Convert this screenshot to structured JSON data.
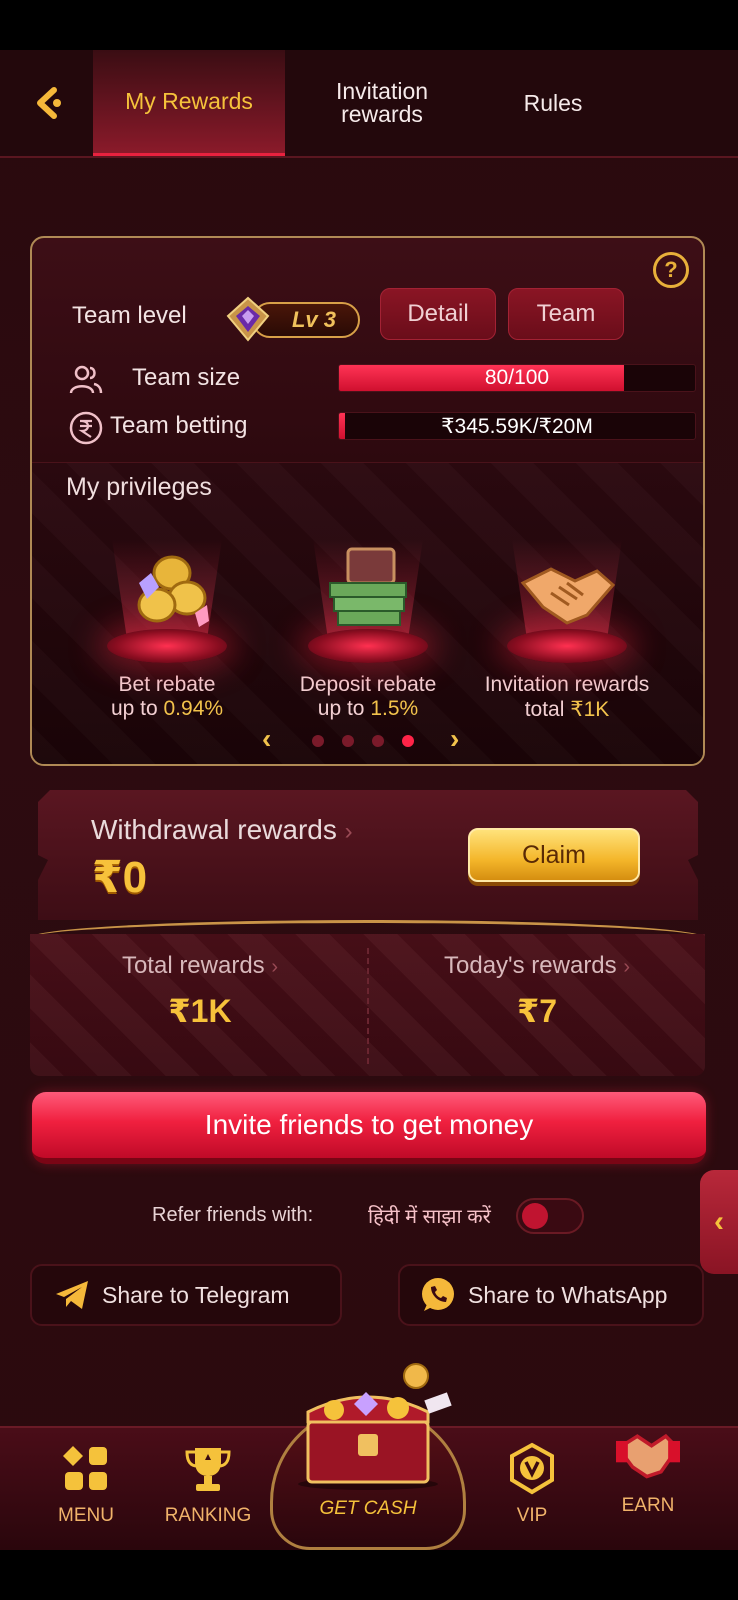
{
  "header": {
    "tabs": [
      {
        "label": "My Rewards",
        "active": true
      },
      {
        "label": "Invitation rewards",
        "active": false
      },
      {
        "label": "Rules",
        "active": false
      }
    ]
  },
  "team": {
    "level_label": "Team level",
    "level_badge": "Lv 3",
    "detail_label": "Detail",
    "team_label": "Team",
    "size_label": "Team size",
    "size_text": "80/100",
    "size_progress": 0.8,
    "betting_label": "Team betting",
    "betting_text": "₹345.59K/₹20M",
    "betting_progress": 0.017
  },
  "privileges": {
    "title": "My privileges",
    "items": [
      {
        "line1": "Bet rebate",
        "prefix": "up to ",
        "value": "0.94%"
      },
      {
        "line1": "Deposit rebate",
        "prefix": "up to ",
        "value": "1.5%"
      },
      {
        "line1": "Invitation rewards",
        "prefix": "total ",
        "value": "₹1K"
      }
    ],
    "pager_active_index": 3,
    "pager_count": 4
  },
  "withdrawal": {
    "label": "Withdrawal rewards",
    "amount": "₹0",
    "claim_label": "Claim"
  },
  "summary": {
    "total_label": "Total rewards",
    "total_value": "₹1K",
    "today_label": "Today's rewards",
    "today_value": "₹7"
  },
  "invite": {
    "button_label": "Invite friends to get money",
    "refer_label": "Refer friends with:",
    "hindi_label": "हिंदी में साझा करें",
    "hindi_enabled": false
  },
  "share": {
    "telegram_label": "Share to Telegram",
    "whatsapp_label": "Share to WhatsApp"
  },
  "bottom_nav": {
    "menu": "MENU",
    "ranking": "RANKING",
    "get_cash": "GET CASH",
    "vip": "VIP",
    "earn": "EARN"
  },
  "colors": {
    "accent_gold": "#f5c23b",
    "accent_red": "#f0203f",
    "background": "#2a0a0e"
  }
}
